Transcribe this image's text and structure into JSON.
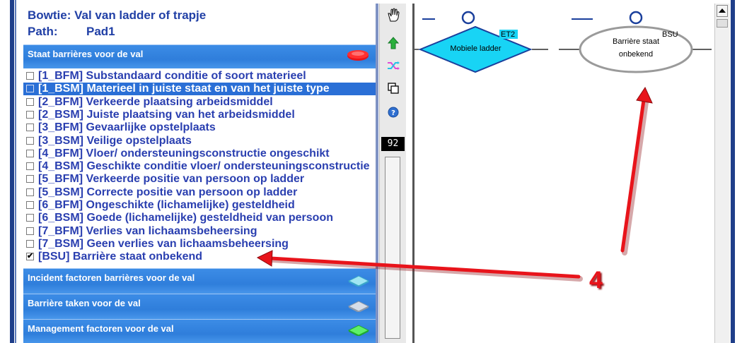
{
  "header": {
    "title": "Bowtie: Val van ladder of trapje",
    "path_label": "Path:",
    "path_value": "Pad1"
  },
  "categories": {
    "barrieres": "Staat barrières voor de val",
    "incident": "Incident factoren barrières voor de val",
    "taken": "Barrière taken voor de val",
    "management": "Management factoren voor de val"
  },
  "items": [
    {
      "label": "[1_BFM] Substandaard conditie of soort materieel",
      "checked": false,
      "selected": false
    },
    {
      "label": "[1_BSM] Materieel in juiste staat en van het juiste type",
      "checked": false,
      "selected": true
    },
    {
      "label": "[2_BFM] Verkeerde plaatsing arbeidsmiddel",
      "checked": false,
      "selected": false
    },
    {
      "label": "[2_BSM] Juiste plaatsing van het arbeidsmiddel",
      "checked": false,
      "selected": false
    },
    {
      "label": "[3_BFM] Gevaarlijke opstelplaats",
      "checked": false,
      "selected": false
    },
    {
      "label": "[3_BSM] Veilige opstelplaats",
      "checked": false,
      "selected": false
    },
    {
      "label": "[4_BFM] Vloer/ ondersteuningsconstructie ongeschikt",
      "checked": false,
      "selected": false
    },
    {
      "label": "[4_BSM] Geschikte conditie vloer/ ondersteuningsconstructie",
      "checked": false,
      "selected": false
    },
    {
      "label": "[5_BFM] Verkeerde positie van persoon op ladder",
      "checked": false,
      "selected": false
    },
    {
      "label": "[5_BSM] Correcte positie van persoon op ladder",
      "checked": false,
      "selected": false
    },
    {
      "label": "[6_BFM] Ongeschikte (lichamelijke) gesteldheid",
      "checked": false,
      "selected": false
    },
    {
      "label": "[6_BSM] Goede (lichamelijke) gesteldheid van persoon",
      "checked": false,
      "selected": false
    },
    {
      "label": "[7_BFM] Verlies van lichaamsbeheersing",
      "checked": false,
      "selected": false
    },
    {
      "label": "[7_BSM] Geen verlies van lichaamsbeheersing",
      "checked": false,
      "selected": false
    },
    {
      "label": "[BSU] Barrière staat onbekend",
      "checked": true,
      "selected": false
    }
  ],
  "toolbar": {
    "counter": "92",
    "tools": [
      "hand-icon",
      "up-arrow-icon",
      "shuffle-icon",
      "copy-icon",
      "help-icon"
    ]
  },
  "diagram": {
    "node1_label": "Mobiele ladder",
    "node1_tag": "ET2",
    "node2_label_line1": "Barrière staat",
    "node2_label_line2": "onbekend",
    "node2_tag": "BSU"
  },
  "annotation": {
    "number": "4"
  },
  "colors": {
    "header_text": "#2140a6",
    "category_bg": "#2f7edb",
    "selected_row": "#2a6fd6",
    "diamond_fill": "#18d4f5",
    "arrow": "#e8141b"
  }
}
